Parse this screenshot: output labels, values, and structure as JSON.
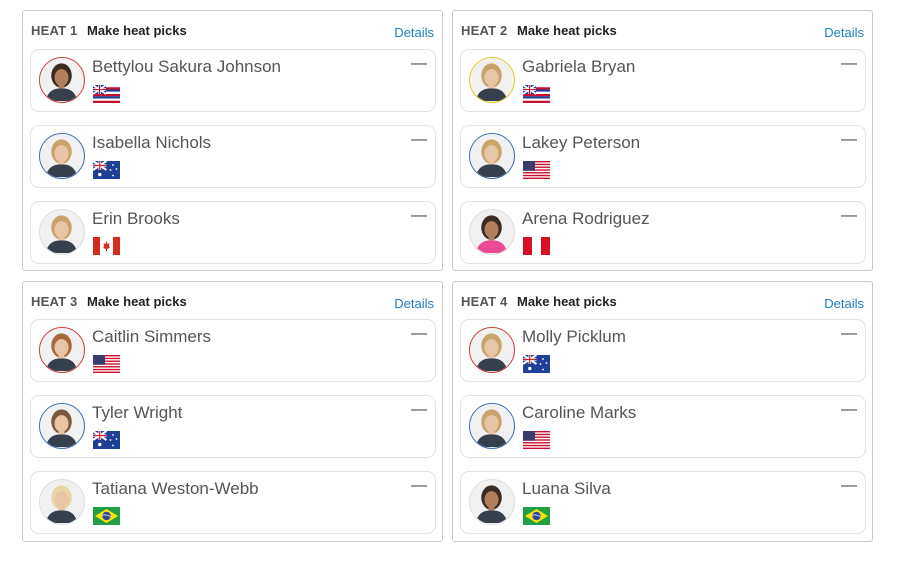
{
  "make_picks_label": "Make heat picks",
  "details_label": "Details",
  "dash": "—",
  "ring_colors": {
    "red": "#d43a3a",
    "blue": "#3d6fb5",
    "yellow": "#e8c92b",
    "none": "#dddddd"
  },
  "heats": [
    {
      "title": "HEAT 1",
      "surfers": [
        {
          "name": "Bettylou Sakura Johnson",
          "flag": "hawaii",
          "ring": "red",
          "jersey": "dark",
          "hair": "dark",
          "skin": "tan"
        },
        {
          "name": "Isabella Nichols",
          "flag": "australia",
          "ring": "blue",
          "jersey": "dark",
          "hair": "blonde",
          "skin": "light"
        },
        {
          "name": "Erin Brooks",
          "flag": "canada",
          "ring": "none",
          "jersey": "dark",
          "hair": "blonde",
          "skin": "light"
        }
      ]
    },
    {
      "title": "HEAT 2",
      "surfers": [
        {
          "name": "Gabriela Bryan",
          "flag": "hawaii",
          "ring": "yellow",
          "jersey": "dark",
          "hair": "blonde",
          "skin": "light"
        },
        {
          "name": "Lakey Peterson",
          "flag": "usa",
          "ring": "blue",
          "jersey": "dark",
          "hair": "blonde",
          "skin": "light"
        },
        {
          "name": "Arena Rodriguez",
          "flag": "peru",
          "ring": "none",
          "jersey": "pink",
          "hair": "dark",
          "skin": "tan"
        }
      ]
    },
    {
      "title": "HEAT 3",
      "surfers": [
        {
          "name": "Caitlin Simmers",
          "flag": "usa",
          "ring": "red",
          "jersey": "dark",
          "hair": "auburn",
          "skin": "light"
        },
        {
          "name": "Tyler Wright",
          "flag": "australia",
          "ring": "blue",
          "jersey": "dark",
          "hair": "brown",
          "skin": "light"
        },
        {
          "name": "Tatiana Weston-Webb",
          "flag": "brazil",
          "ring": "none",
          "jersey": "dark",
          "hair": "platinum",
          "skin": "light"
        }
      ]
    },
    {
      "title": "HEAT 4",
      "surfers": [
        {
          "name": "Molly Picklum",
          "flag": "australia",
          "ring": "red",
          "jersey": "dark",
          "hair": "blonde",
          "skin": "light"
        },
        {
          "name": "Caroline Marks",
          "flag": "usa",
          "ring": "blue",
          "jersey": "dark",
          "hair": "blonde",
          "skin": "light"
        },
        {
          "name": "Luana Silva",
          "flag": "brazil",
          "ring": "none",
          "jersey": "dark",
          "hair": "dark",
          "skin": "tan"
        }
      ]
    }
  ]
}
